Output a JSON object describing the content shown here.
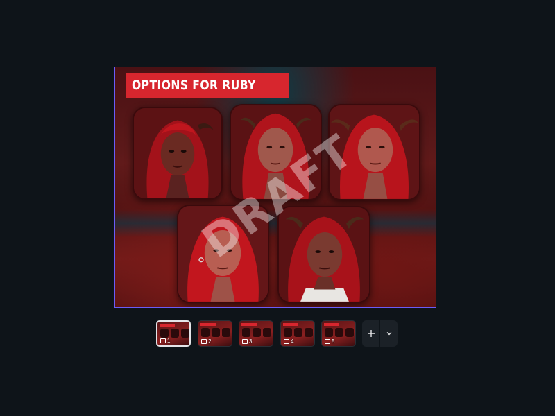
{
  "slide": {
    "title": "OPTIONS FOR RUBY",
    "watermark": "DRAFT",
    "selection_border_color": "#6b5cf6",
    "banner_color": "#d7262e"
  },
  "filmstrip": {
    "thumbnails": [
      {
        "number": "1",
        "active": true
      },
      {
        "number": "2",
        "active": false
      },
      {
        "number": "3",
        "active": false
      },
      {
        "number": "4",
        "active": false
      },
      {
        "number": "5",
        "active": false
      }
    ],
    "add_icon": "plus-icon",
    "more_icon": "chevron-down-icon"
  }
}
